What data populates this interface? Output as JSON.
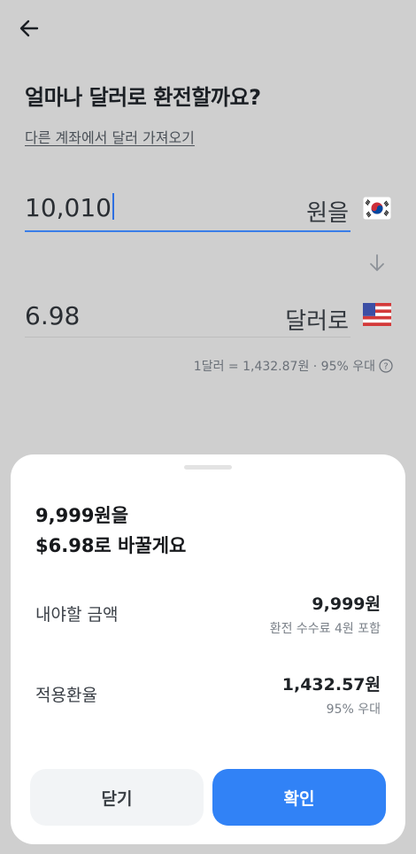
{
  "header": {
    "title": "얼마나 달러로 환전할까요?",
    "link_text": "다른 계좌에서 달러 가져오기"
  },
  "exchange": {
    "from_amount": "10,010",
    "from_unit": "원을",
    "from_flag": "korea-flag-icon",
    "to_amount": "6.98",
    "to_unit": "달러로",
    "to_flag": "us-flag-icon",
    "rate_text": "1달러 = 1,432.87원 · 95% 우대"
  },
  "sheet": {
    "title_line1": "9,999원을",
    "title_line2": "$6.98로 바꿀게요",
    "pay_label": "내야할 금액",
    "pay_value": "9,999원",
    "pay_sub": "환전 수수료 4원 포함",
    "rate_label": "적용환율",
    "rate_value": "1,432.57원",
    "rate_sub": "95% 우대",
    "close_label": "닫기",
    "confirm_label": "확인"
  },
  "colors": {
    "accent": "#3182f6",
    "background_dim": "#cfcfcf",
    "sheet_bg": "#ffffff"
  }
}
